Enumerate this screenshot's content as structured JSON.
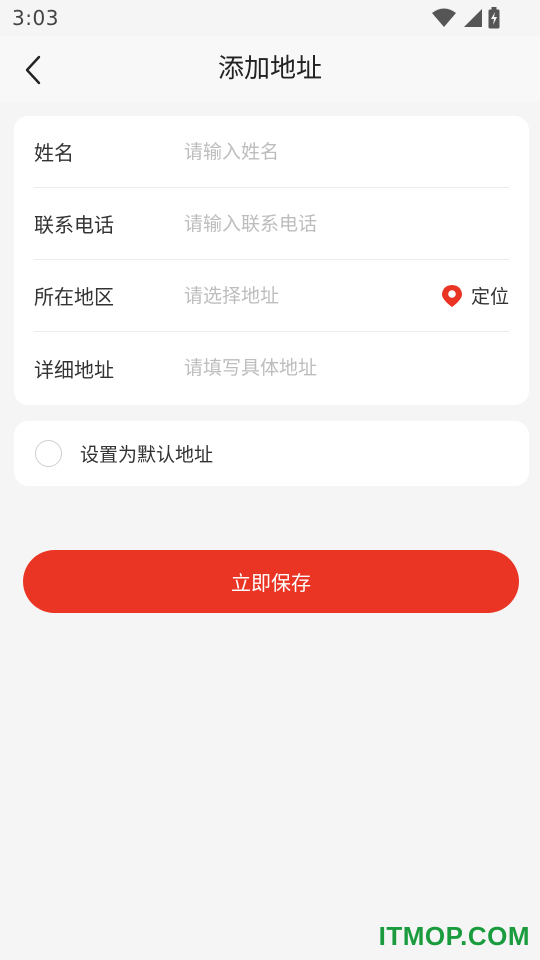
{
  "status_bar": {
    "time": "3:03",
    "icons": [
      "wifi-icon",
      "signal-icon",
      "battery-icon"
    ]
  },
  "header": {
    "title": "添加地址",
    "back_icon": "chevron-left-icon"
  },
  "form": {
    "name": {
      "label": "姓名",
      "placeholder": "请输入姓名",
      "value": ""
    },
    "phone": {
      "label": "联系电话",
      "placeholder": "请输入联系电话",
      "value": ""
    },
    "region": {
      "label": "所在地区",
      "placeholder": "请选择地址",
      "value": "",
      "locate_label": "定位",
      "locate_icon": "location-pin-icon"
    },
    "detail": {
      "label": "详细地址",
      "placeholder": "请填写具体地址",
      "value": ""
    }
  },
  "default_option": {
    "label": "设置为默认地址",
    "checked": false
  },
  "save_button": {
    "label": "立即保存"
  },
  "watermark": {
    "text": "ITMOP.COM"
  },
  "colors": {
    "accent": "#ea3424",
    "background": "#f5f5f5",
    "card": "#ffffff",
    "placeholder": "#bdbdbd",
    "watermark": "#1a9c3e"
  }
}
